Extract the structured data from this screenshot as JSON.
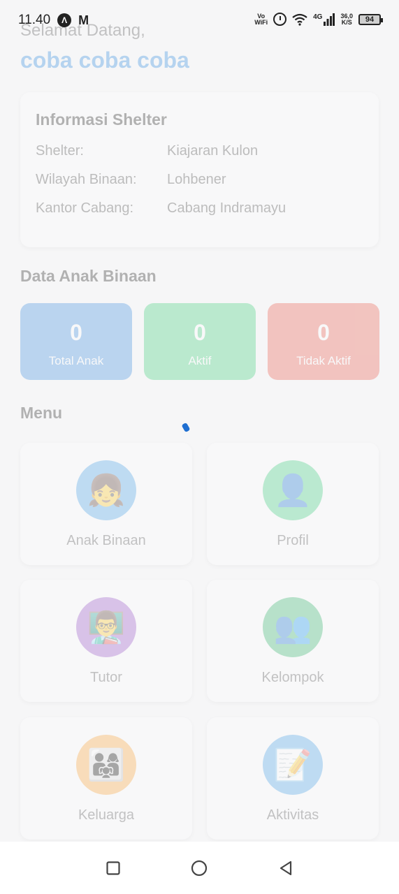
{
  "status_bar": {
    "time": "11.40",
    "vowifi_line1": "Vo",
    "vowifi_line2": "WiFi",
    "network": "4G",
    "speed_value": "36,0",
    "speed_unit": "K/S",
    "battery": "94"
  },
  "header": {
    "greeting": "Selamat Datang,",
    "user_name": "coba coba coba"
  },
  "shelter_info": {
    "title": "Informasi Shelter",
    "rows": [
      {
        "label": "Shelter:",
        "value": "Kiajaran Kulon"
      },
      {
        "label": "Wilayah Binaan:",
        "value": "Lohbener"
      },
      {
        "label": "Kantor Cabang:",
        "value": "Cabang Indramayu"
      }
    ]
  },
  "stats": {
    "title": "Data Anak Binaan",
    "items": [
      {
        "value": "0",
        "label": "Total Anak",
        "color": "#3d8fe0"
      },
      {
        "value": "0",
        "label": "Aktif",
        "color": "#3fcf7a"
      },
      {
        "value": "0",
        "label": "Tidak Aktif",
        "color": "#ea5a4b"
      }
    ]
  },
  "menu": {
    "title": "Menu",
    "items": [
      {
        "label": "Anak Binaan",
        "icon": "girl-icon",
        "glyph": "👧",
        "color": "#4aa3ea"
      },
      {
        "label": "Profil",
        "icon": "person-silhouette-icon",
        "glyph": "👤",
        "color": "#3fd07f"
      },
      {
        "label": "Tutor",
        "icon": "teacher-icon",
        "glyph": "👨‍🏫",
        "color": "#9a56c9"
      },
      {
        "label": "Kelompok",
        "icon": "group-icon",
        "glyph": "👥",
        "color": "#34b66d"
      },
      {
        "label": "Keluarga",
        "icon": "family-icon",
        "glyph": "👨‍👩‍👧",
        "color": "#ffa73c"
      },
      {
        "label": "Aktivitas",
        "icon": "memo-icon",
        "glyph": "📝",
        "color": "#4aa3ea"
      }
    ]
  }
}
